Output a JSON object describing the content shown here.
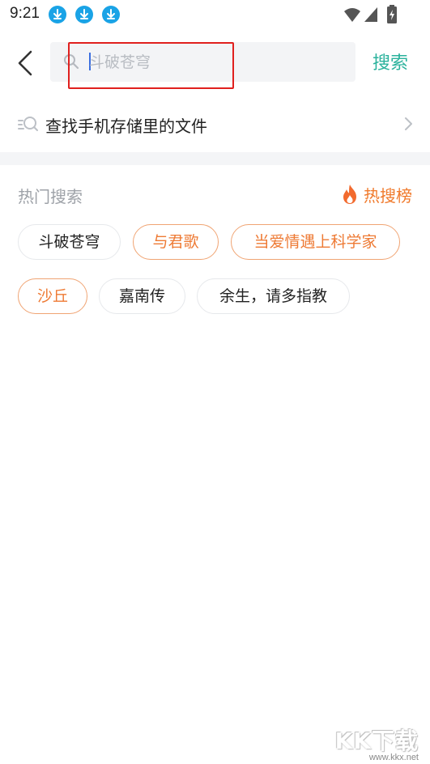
{
  "status_bar": {
    "time": "9:21",
    "icons": [
      "download-icon",
      "download-icon",
      "download-icon",
      "wifi-icon",
      "signal-icon",
      "battery-icon"
    ]
  },
  "header": {
    "search_placeholder": "斗破苍穹",
    "search_value": "",
    "search_button": "搜索",
    "colors": {
      "accent": "#2ab29c",
      "highlight": "#e0201e",
      "caret": "#3b6fe0"
    }
  },
  "local_search": {
    "label": "查找手机存储里的文件"
  },
  "hot_search": {
    "title": "热门搜索",
    "rank_label": "热搜榜",
    "colors": {
      "hot": "#ee7a34",
      "hot_border": "#f0a473"
    },
    "tags": [
      {
        "label": "斗破苍穹",
        "hot": false
      },
      {
        "label": "与君歌",
        "hot": true
      },
      {
        "label": "当爱情遇上科学家",
        "hot": true
      },
      {
        "label": "沙丘",
        "hot": true
      },
      {
        "label": "嘉南传",
        "hot": false
      },
      {
        "label": "余生，请多指教",
        "hot": false
      }
    ]
  },
  "watermark": {
    "brand": "KK下载",
    "url": "www.kkx.net"
  }
}
